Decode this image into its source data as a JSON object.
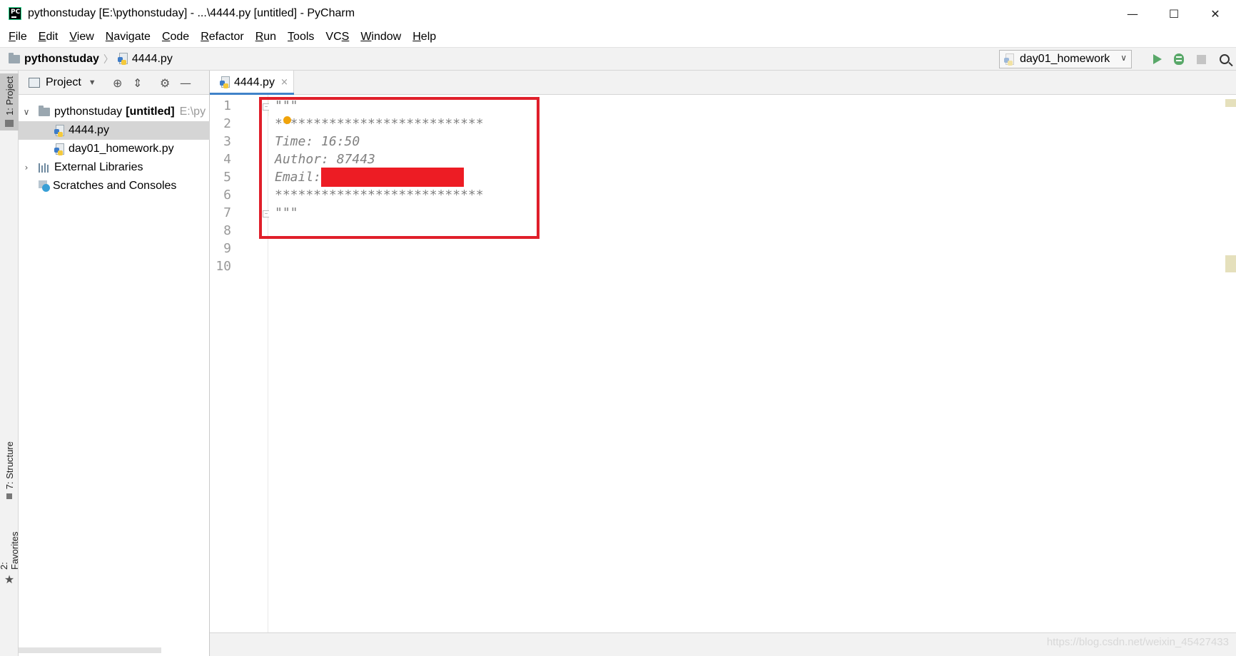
{
  "window": {
    "title": "pythonstuday [E:\\pythonstuday] - ...\\4444.py [untitled] - PyCharm",
    "app_icon": "PC",
    "controls": {
      "minimize": "—",
      "maximize": "☐",
      "close": "✕"
    }
  },
  "menu": [
    {
      "mnemonic": "F",
      "rest": "ile"
    },
    {
      "mnemonic": "E",
      "rest": "dit"
    },
    {
      "mnemonic": "V",
      "rest": "iew"
    },
    {
      "mnemonic": "N",
      "rest": "avigate"
    },
    {
      "mnemonic": "C",
      "rest": "ode"
    },
    {
      "mnemonic": "R",
      "rest": "efactor"
    },
    {
      "mnemonic": "R",
      "rest": "un"
    },
    {
      "mnemonic": "T",
      "rest": "ools"
    },
    {
      "mnemonic": "VC",
      "rest": "S"
    },
    {
      "mnemonic": "W",
      "rest": "indow"
    },
    {
      "mnemonic": "H",
      "rest": "elp"
    }
  ],
  "breadcrumb": {
    "project": "pythonstuday",
    "file": "4444.py",
    "separator": "〉"
  },
  "run_config": {
    "label": "day01_homework",
    "chevron": "∨"
  },
  "left_strip": {
    "project_tab": "1: Project",
    "structure_tab": "7: Structure",
    "favorites_tab": "2: Favorites",
    "star": "★"
  },
  "project_panel": {
    "title": "Project",
    "chevron": "▼",
    "header_icons": {
      "locate": "⊕",
      "collapse": "⇕",
      "settings": "⚙",
      "hide": "—"
    },
    "tree": {
      "root": {
        "name": "pythonstuday",
        "tag": "[untitled]",
        "path": "E:\\py",
        "toggle": "∨"
      },
      "file1": "4444.py",
      "file2": "day01_homework.py",
      "external": {
        "name": "External Libraries",
        "toggle": "›"
      },
      "scratches": "Scratches and Consoles"
    }
  },
  "editor": {
    "tab": {
      "label": "4444.py",
      "close": "×"
    },
    "line_numbers": [
      "1",
      "2",
      "3",
      "4",
      "5",
      "6",
      "7",
      "8",
      "9",
      "10"
    ],
    "lines": [
      "\"\"\"",
      "***************************",
      "Time: 16:50",
      "Author: 87443",
      "Email:",
      "***************************",
      "\"\"\"",
      "",
      "",
      ""
    ],
    "fold": {
      "open": "−",
      "close": "−"
    }
  },
  "watermark": "https://blog.csdn.net/weixin_45427433"
}
